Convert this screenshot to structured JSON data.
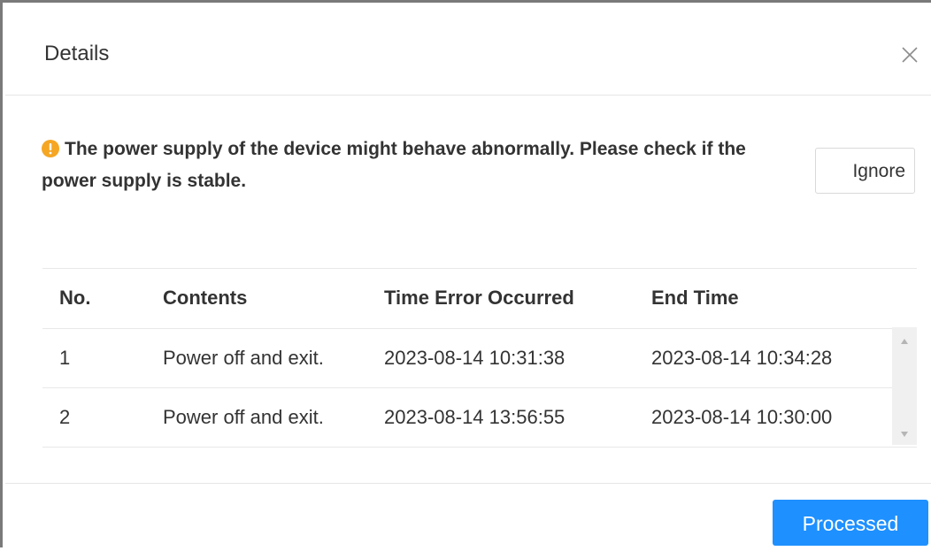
{
  "dialog": {
    "title": "Details",
    "close_icon": "close-icon"
  },
  "alert": {
    "icon": "warning-icon",
    "icon_color": "#f5a623",
    "message": "The power supply of the device might behave abnormally. Please check if the power supply is stable."
  },
  "actions": {
    "ignore_label": "Ignore",
    "processed_label": "Processed",
    "primary_color": "#1e90ff"
  },
  "table": {
    "headers": {
      "no": "No.",
      "contents": "Contents",
      "time_error": "Time Error Occurred",
      "end_time": "End Time"
    },
    "rows": [
      {
        "no": "1",
        "contents": "Power off and exit.",
        "time_error": "2023-08-14 10:31:38",
        "end_time": "2023-08-14 10:34:28"
      },
      {
        "no": "2",
        "contents": "Power off and exit.",
        "time_error": "2023-08-14 13:56:55",
        "end_time": "2023-08-14 10:30:00"
      }
    ]
  }
}
